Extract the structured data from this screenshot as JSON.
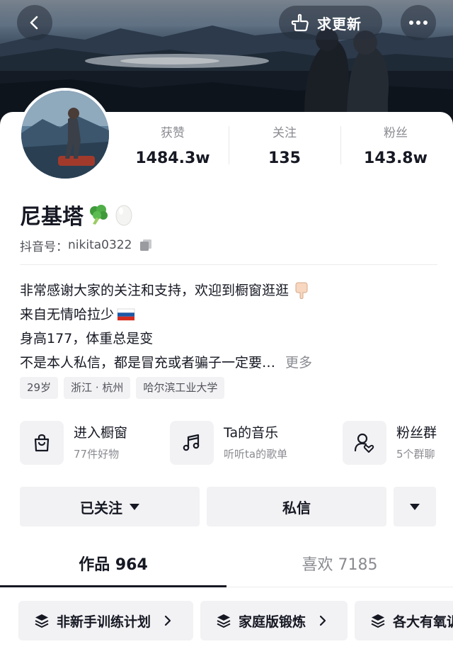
{
  "header": {
    "update_label": "求更新",
    "icons": {
      "back": "back-arrow-icon",
      "update": "pointing-hand-icon",
      "more": "more-dots-icon"
    }
  },
  "stats": [
    {
      "label": "获赞",
      "value": "1484.3w"
    },
    {
      "label": "关注",
      "value": "135"
    },
    {
      "label": "粉丝",
      "value": "143.8w"
    }
  ],
  "profile": {
    "name": "尼基塔",
    "name_emojis": [
      "broccoli-emoji",
      "egg-emoji"
    ],
    "id_label": "抖音号：",
    "id_value": "nikita0322"
  },
  "bio": {
    "lines": [
      "非常感谢大家的关注和支持，欢迎到橱窗逛逛",
      "来自无情哈拉少",
      "身高177，体重总是变",
      "不是本人私信，都是冒充或者骗子一定要…"
    ],
    "line_emojis": [
      "pointing-down-hand-emoji",
      "russian-flag-emoji"
    ],
    "more_label": "更多"
  },
  "tags": [
    "29岁",
    "浙江 · 杭州",
    "哈尔滨工业大学"
  ],
  "services": [
    {
      "title": "进入橱窗",
      "subtitle": "77件好物",
      "icon": "shopping-bag-icon"
    },
    {
      "title": "Ta的音乐",
      "subtitle": "听听ta的歌单",
      "icon": "music-note-icon"
    },
    {
      "title": "粉丝群",
      "subtitle": "5个群聊",
      "icon": "fan-group-icon"
    }
  ],
  "actions": {
    "follow_label": "已关注",
    "message_label": "私信"
  },
  "tabs": [
    {
      "label": "作品 964"
    },
    {
      "label": "喜欢 7185"
    }
  ],
  "chips": [
    {
      "label": "非新手训练计划"
    },
    {
      "label": "家庭版锻炼"
    },
    {
      "label": "各大有氧训练"
    }
  ],
  "colors": {
    "text_primary": "#161823",
    "text_secondary": "#8a8b91",
    "surface": "#f2f2f4"
  }
}
